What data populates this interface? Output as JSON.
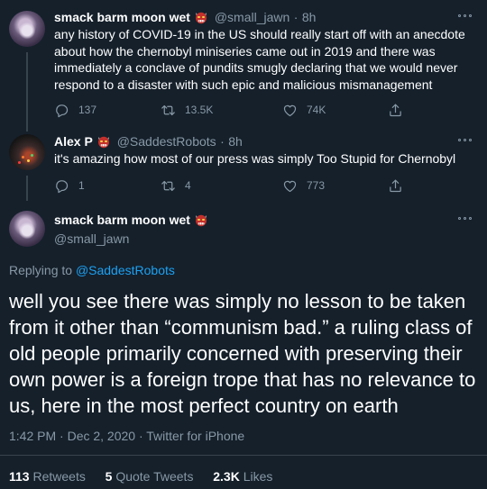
{
  "tweets": [
    {
      "name": "smack barm moon wet",
      "handle": "@small_jawn",
      "sep": "·",
      "time": "8h",
      "text": "any history of COVID-19 in the US should really start off with an anecdote about how the chernobyl miniseries came out in 2019 and there was immediately a conclave of pundits smugly declaring that we would never respond to a disaster with such epic and malicious mismanagement",
      "replies": "137",
      "retweets": "13.5K",
      "likes": "74K"
    },
    {
      "name": "Alex P",
      "handle": "@SaddestRobots",
      "sep": "·",
      "time": "8h",
      "text": "it's amazing how most of our press was simply Too Stupid for Chernobyl",
      "replies": "1",
      "retweets": "4",
      "likes": "773"
    }
  ],
  "main_tweet": {
    "name": "smack barm moon wet",
    "handle": "@small_jawn",
    "replying_prefix": "Replying to",
    "replying_to": "@SaddestRobots",
    "text": "well you see there was simply no lesson to be taken from it other than “communism bad.” a ruling class of old people primarily concerned with preserving their own power is a foreign trope that has no relevance to us, here in the most perfect country on earth",
    "timestamp": "1:42 PM · Dec 2, 2020 · Twitter for iPhone",
    "retweets_count": "113",
    "retweets_label": "Retweets",
    "quotes_count": "5",
    "quotes_label": "Quote Tweets",
    "likes_count": "2.3K",
    "likes_label": "Likes"
  },
  "colors": {
    "background": "#15202b",
    "secondary_text": "#8899a6",
    "link": "#1da1f2",
    "divider": "#38444d"
  },
  "icons": [
    "ogre-emoji-icon",
    "reply-icon",
    "retweet-icon",
    "like-icon",
    "share-icon",
    "more-icon"
  ]
}
